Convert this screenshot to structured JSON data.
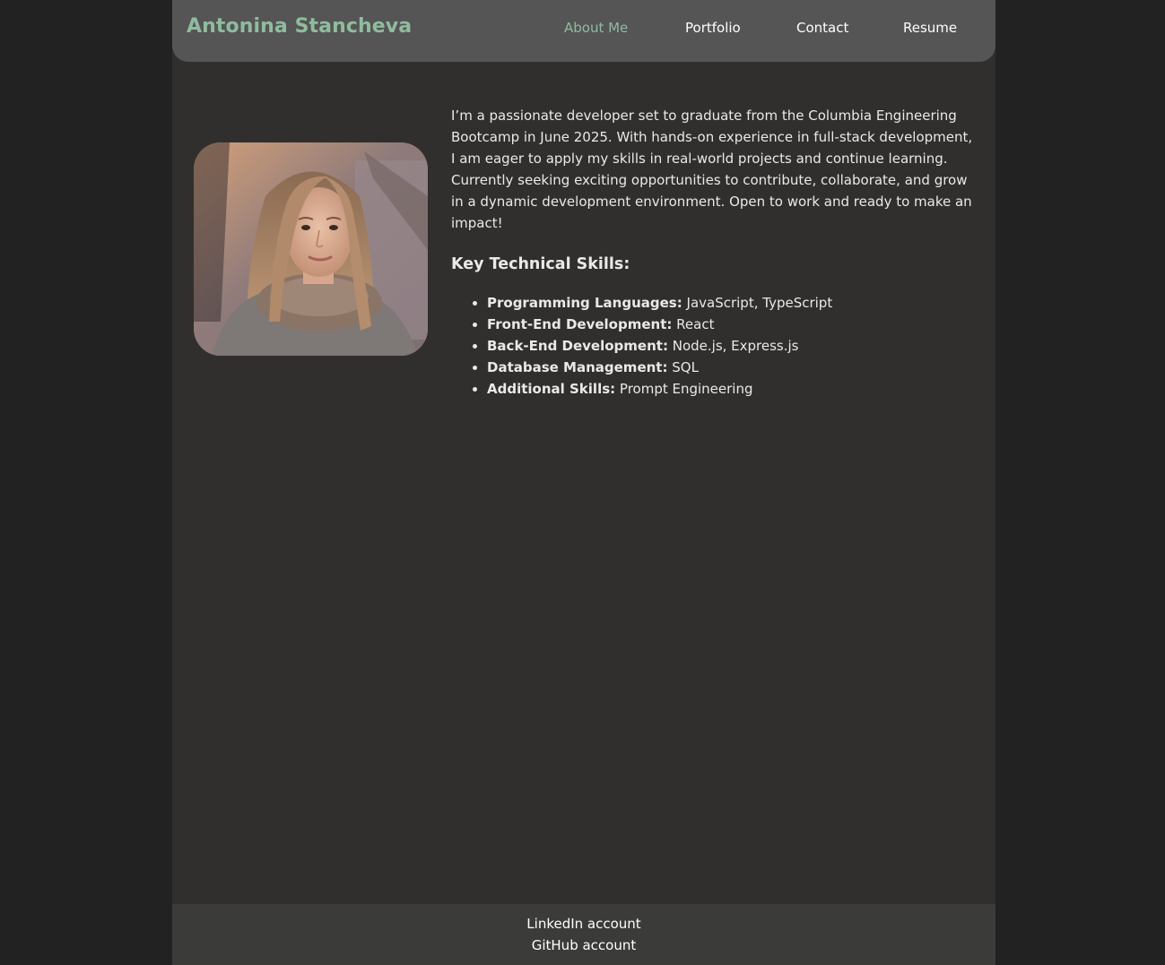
{
  "header": {
    "brand": "Antonina Stancheva",
    "nav": [
      {
        "label": "About Me",
        "active": true
      },
      {
        "label": "Portfolio",
        "active": false
      },
      {
        "label": "Contact",
        "active": false
      },
      {
        "label": "Resume",
        "active": false
      }
    ]
  },
  "about": {
    "photo_alt": "profile-photo",
    "bio": "I’m a passionate developer set to graduate from the Columbia Engineering Bootcamp in June 2025. With hands-on experience in full-stack development, I am eager to apply my skills in real-world projects and continue learning. Currently seeking exciting opportunities to contribute, collaborate, and grow in a dynamic development environment. Open to work and ready to make an impact!",
    "skills_heading": "Key Technical Skills:",
    "skills": [
      {
        "label": "Programming Languages:",
        "value": "JavaScript, TypeScript"
      },
      {
        "label": "Front-End Development:",
        "value": "React"
      },
      {
        "label": "Back-End Development:",
        "value": "Node.js, Express.js"
      },
      {
        "label": "Database Management:",
        "value": "SQL"
      },
      {
        "label": "Additional Skills:",
        "value": "Prompt Engineering"
      }
    ]
  },
  "footer": {
    "links": [
      "LinkedIn account",
      "GitHub account"
    ]
  },
  "colors": {
    "accent": "#8fbc9f",
    "background": "#302f2d",
    "header_bg": "#555555",
    "footer_bg": "#3b3b3a"
  }
}
